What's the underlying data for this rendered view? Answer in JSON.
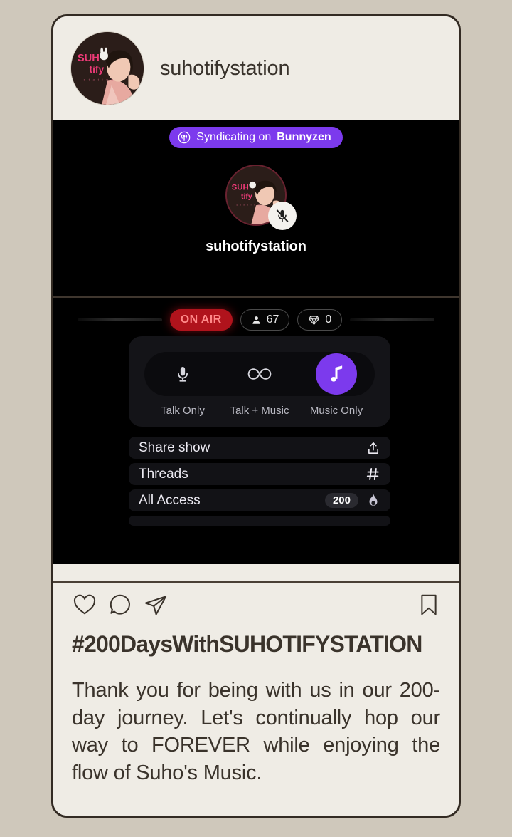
{
  "colors": {
    "page_background": "#cfc8bb",
    "card_background": "#efece5",
    "card_border": "#332b23",
    "stream_background": "#000000",
    "accent_purple": "#7c3aed",
    "onair_red": "#b0131c",
    "text_dark": "#3a332b"
  },
  "header": {
    "username": "suhotifystation",
    "avatar_icon": "profile-avatar",
    "avatar_logo_line1": "SUH",
    "avatar_logo_line2": "tify",
    "avatar_logo_line3": "s t a t i o n"
  },
  "stream": {
    "syndicate": {
      "icon": "broadcast-icon",
      "prefix": "Syndicating on ",
      "platform": "Bunnyzen"
    },
    "host": {
      "username": "suhotifystation",
      "avatar_icon": "profile-avatar",
      "mute_icon": "mic-muted-icon"
    },
    "status": {
      "on_air_label": "ON AIR",
      "viewers_icon": "person-icon",
      "viewers_count": "67",
      "gems_icon": "diamond-icon",
      "gems_count": "0"
    },
    "modes": [
      {
        "icon": "microphone-icon",
        "label": "Talk Only",
        "selected": false
      },
      {
        "icon": "infinity-icon",
        "label": "Talk + Music",
        "selected": false
      },
      {
        "icon": "music-note-icon",
        "label": "Music Only",
        "selected": true
      }
    ],
    "menu_rows": [
      {
        "label": "Share show",
        "icon": "share-upload-icon",
        "badge": ""
      },
      {
        "label": "Threads",
        "icon": "hash-icon",
        "badge": ""
      },
      {
        "label": "All Access",
        "icon": "flame-icon",
        "badge": "200"
      }
    ]
  },
  "actions": {
    "like_icon": "heart-icon",
    "comment_icon": "comment-icon",
    "share_icon": "paper-plane-icon",
    "save_icon": "bookmark-icon"
  },
  "caption": {
    "hashtag": "#200DaysWithSUHOTIFYSTATION",
    "body": "Thank you for being with us in our 200-day journey. Let's continually hop our way to FOREVER while enjoying the flow of Suho's Music."
  }
}
